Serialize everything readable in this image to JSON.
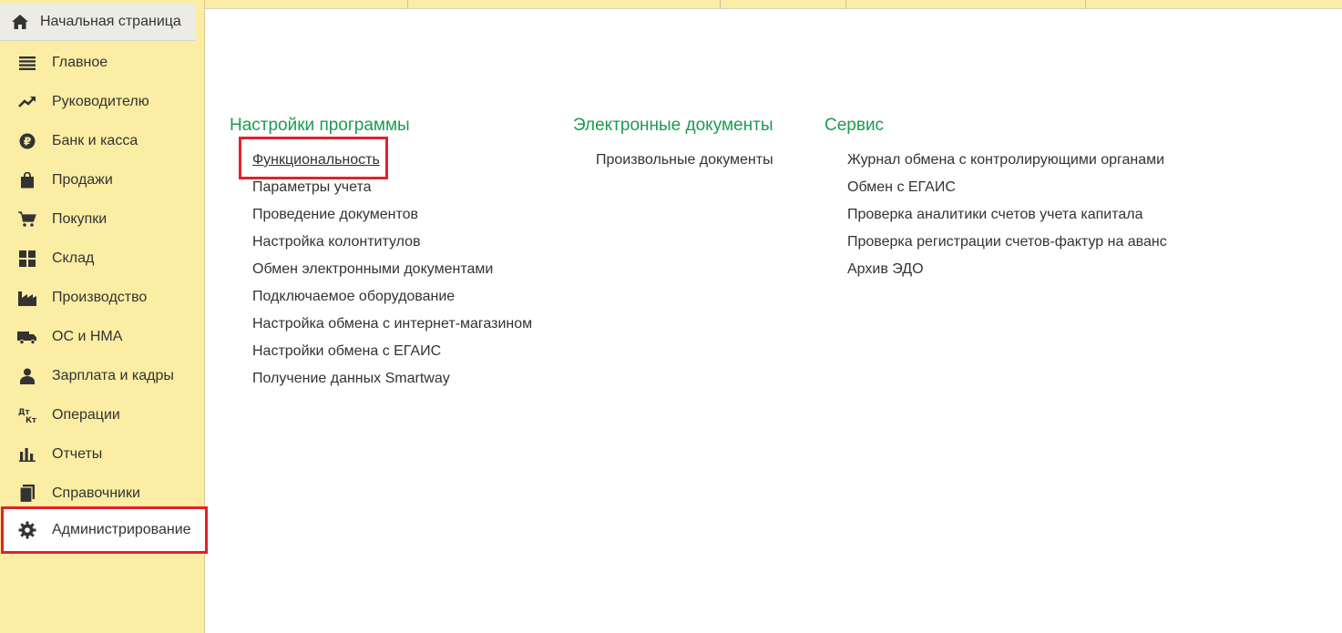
{
  "sidebar": {
    "home_label": "Начальная страница",
    "items": [
      {
        "label": "Главное",
        "icon": "list-icon"
      },
      {
        "label": "Руководителю",
        "icon": "trend-up-icon"
      },
      {
        "label": "Банк и касса",
        "icon": "ruble-icon"
      },
      {
        "label": "Продажи",
        "icon": "shopping-bag-icon"
      },
      {
        "label": "Покупки",
        "icon": "cart-icon"
      },
      {
        "label": "Склад",
        "icon": "warehouse-icon"
      },
      {
        "label": "Производство",
        "icon": "factory-icon"
      },
      {
        "label": "ОС и НМА",
        "icon": "truck-icon"
      },
      {
        "label": "Зарплата и кадры",
        "icon": "person-icon"
      },
      {
        "label": "Операции",
        "icon": "dt-kt-icon"
      },
      {
        "label": "Отчеты",
        "icon": "bar-chart-icon"
      },
      {
        "label": "Справочники",
        "icon": "book-icon"
      },
      {
        "label": "Администрирование",
        "icon": "gear-icon",
        "active": true
      }
    ],
    "dt_kt_text": {
      "top": "Дт",
      "bottom": "Кт"
    }
  },
  "main": {
    "sections": [
      {
        "title": "Настройки программы",
        "links": [
          "Функциональность",
          "Параметры учета",
          "Проведение документов",
          "Настройка колонтитулов",
          "Обмен электронными документами",
          "Подключаемое оборудование",
          "Настройка обмена с интернет-магазином",
          "Настройки обмена с ЕГАИС",
          "Получение данных Smartway"
        ]
      },
      {
        "title": "Электронные документы",
        "links": [
          "Произвольные документы"
        ]
      },
      {
        "title": "Сервис",
        "links": [
          "Журнал обмена с контролирующими органами",
          "Обмен с ЕГАИС",
          "Проверка аналитики счетов учета капитала",
          "Проверка регистрации счетов-фактур на аванс",
          "Архив ЭДО"
        ]
      }
    ]
  },
  "colors": {
    "sidebar_bg": "#fbeda3",
    "section_title": "#1e9a52",
    "highlight": "#e3212b"
  }
}
